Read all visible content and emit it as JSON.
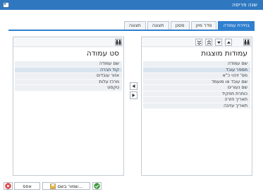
{
  "window": {
    "title": "שנה פריסה"
  },
  "tabs": [
    {
      "label": "בחירת עמודה",
      "active": true
    },
    {
      "label": "סדר מיון",
      "active": false
    },
    {
      "label": "מסנן",
      "active": false
    },
    {
      "label": "תצוגה",
      "active": false
    },
    {
      "label": "תצוגה",
      "active": false
    }
  ],
  "displayed_columns": {
    "heading": "עמודות מוצגות",
    "items": [
      "שם עמודה",
      "מספר עובד",
      "מס' זיהוי כ\"א",
      "שם עובד או מועמד",
      "שם נעורים",
      "כותרת תפקיד",
      "תאריך חזרה",
      "תאריך עזיבה"
    ],
    "selected_index": 1
  },
  "column_set": {
    "heading": "סט עמודה",
    "items": [
      "שם עמודה",
      "קוד חברה",
      "אזור עובדים",
      "מרכז עלות",
      "טקסט"
    ],
    "selected_index": 1
  },
  "footer": {
    "save_as_label": "שמור בשם...",
    "cancel_label": "אפס"
  },
  "colors": {
    "title_bar": "#2f78c0",
    "accent": "#2f7fcf",
    "confirm": "#3a9a3a",
    "cancel": "#d63a3a"
  }
}
